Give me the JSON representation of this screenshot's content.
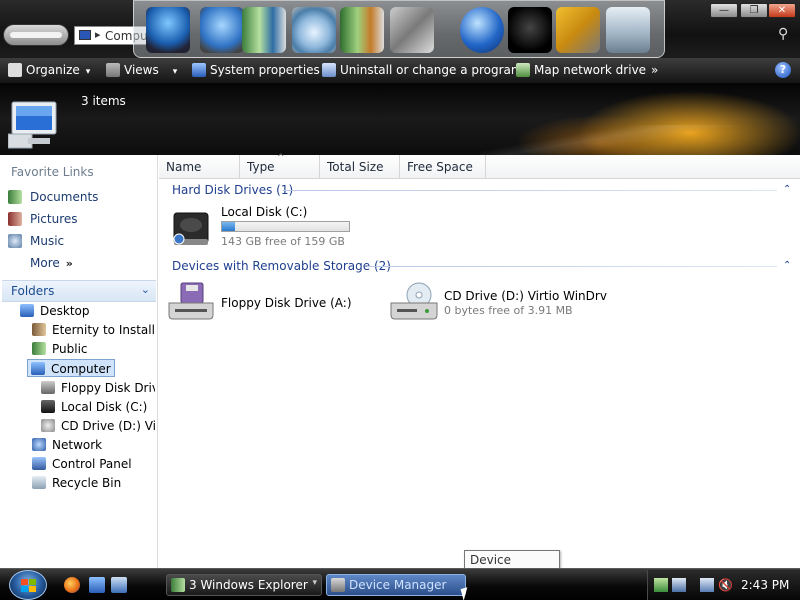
{
  "window": {
    "address_text": "Compu",
    "buttons": {
      "minimize": "—",
      "maximize": "❐",
      "close": "✕"
    }
  },
  "dock": {
    "icons": [
      "computer-monitor-icon",
      "network-computer-icon",
      "documents-icon",
      "cd-burn-icon",
      "pictures-folder-icon",
      "tools-icon",
      "internet-globe-icon",
      "tshirt-icon",
      "settings-tools-icon",
      "recycle-bin-icon"
    ]
  },
  "toolbar": {
    "organize": "Organize",
    "views": "Views",
    "system_properties": "System properties",
    "uninstall": "Uninstall or change a program",
    "map_drive": "Map network drive",
    "overflow": "»",
    "help": "?"
  },
  "header": {
    "items_count": "3 items"
  },
  "favorite_links": {
    "title": "Favorite Links",
    "items": [
      {
        "label": "Documents",
        "icon": "documents-icon"
      },
      {
        "label": "Pictures",
        "icon": "pictures-icon"
      },
      {
        "label": "Music",
        "icon": "music-icon"
      }
    ],
    "more": "More",
    "more_chevron": "»"
  },
  "folders": {
    "label": "Folders",
    "chevron": "⌄",
    "tree": [
      {
        "label": "Desktop",
        "icon": "desktop-icon",
        "level": 1
      },
      {
        "label": "Eternity to Install",
        "icon": "folder-user-icon",
        "level": 2
      },
      {
        "label": "Public",
        "icon": "folder-public-icon",
        "level": 2
      },
      {
        "label": "Computer",
        "icon": "computer-icon",
        "level": 2,
        "selected": true
      },
      {
        "label": "Floppy Disk Drive",
        "icon": "floppy-drive-icon",
        "level": 3
      },
      {
        "label": "Local Disk (C:)",
        "icon": "hard-disk-icon",
        "level": 3
      },
      {
        "label": "CD Drive (D:) Virtio",
        "icon": "cd-drive-icon",
        "level": 3
      },
      {
        "label": "Network",
        "icon": "network-icon",
        "level": 2
      },
      {
        "label": "Control Panel",
        "icon": "control-panel-icon",
        "level": 2
      },
      {
        "label": "Recycle Bin",
        "icon": "recycle-bin-icon",
        "level": 2
      }
    ]
  },
  "columns": [
    {
      "label": "Name"
    },
    {
      "label": "Type"
    },
    {
      "label": "Total Size"
    },
    {
      "label": "Free Space"
    }
  ],
  "groups": {
    "hard_disk": {
      "title": "Hard Disk Drives (1)",
      "drive": {
        "name": "Local Disk (C:)",
        "sub": "143 GB free of 159 GB",
        "used_fraction": 0.1
      }
    },
    "removable": {
      "title": "Devices with Removable Storage (2)",
      "floppy": {
        "name": "Floppy Disk Drive (A:)"
      },
      "cd": {
        "name": "CD Drive (D:) Virtio WinDrv",
        "sub": "0 bytes free of 3.91 MB"
      }
    },
    "collapse_chevron": "⌃"
  },
  "tooltip": "Device Manager",
  "taskbar": {
    "task_explorer": "3 Windows Explorer",
    "task_explorer_arrow": "▾",
    "task_device_manager": "Device Manager",
    "clock": "2:43 PM"
  }
}
